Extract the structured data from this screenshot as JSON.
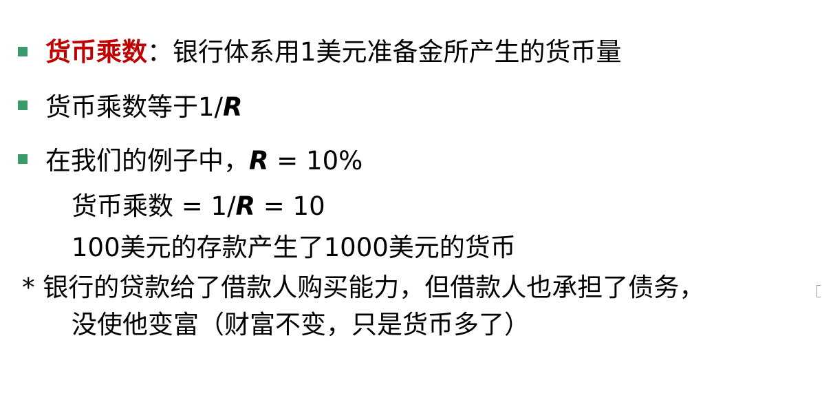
{
  "bullet_color": "#3a9a68",
  "highlight_color": "#c00000",
  "item1": {
    "term": "货币乘数",
    "colon": "：",
    "definition": "银行体系用1美元准备金所产生的货币量"
  },
  "item2": {
    "text": "货币乘数等于1/",
    "var": "R"
  },
  "item3": {
    "text": "在我们的例子中，",
    "var": "R",
    "value": " = 10%"
  },
  "sub1": {
    "text_a": "货币乘数 = 1/",
    "var": "R",
    "text_b": " = 10"
  },
  "sub2": {
    "text": "100美元的存款产生了1000美元的货币"
  },
  "note": {
    "line1": "* 银行的贷款给了借款人购买能力，但借款人也承担了债务，",
    "line2": "没使他变富（财富不变，只是货币多了）"
  }
}
